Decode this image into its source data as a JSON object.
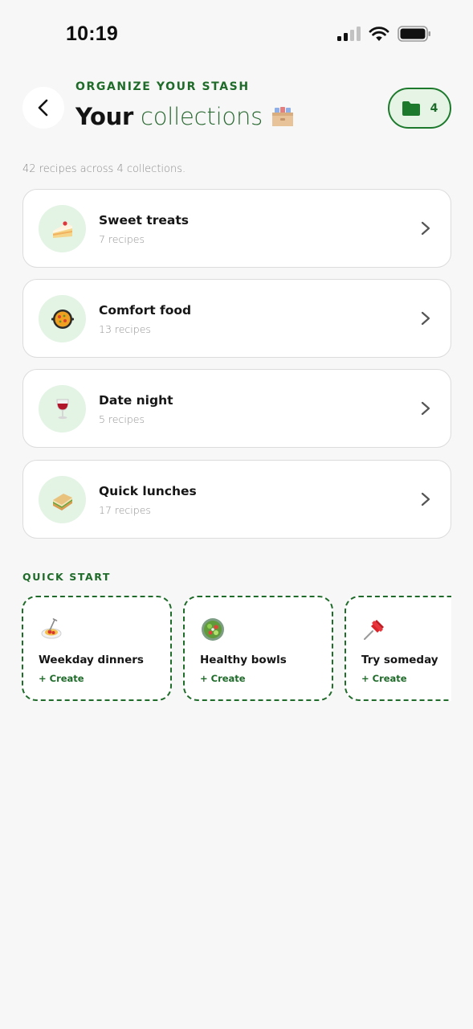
{
  "status_bar": {
    "time": "10:19"
  },
  "header": {
    "eyebrow": "ORGANIZE YOUR STASH",
    "title_strong": "Your",
    "title_light": "collections",
    "collections_count": "4"
  },
  "summary": "42 recipes across 4 collections.",
  "collections": [
    {
      "name": "Sweet treats",
      "count_label": "7 recipes",
      "icon": "cake-slice-icon"
    },
    {
      "name": "Comfort food",
      "count_label": "13 recipes",
      "icon": "paella-pan-icon"
    },
    {
      "name": "Date night",
      "count_label": "5 recipes",
      "icon": "wine-glass-icon"
    },
    {
      "name": "Quick lunches",
      "count_label": "17 recipes",
      "icon": "sandwich-icon"
    }
  ],
  "quick_start": {
    "label": "QUICK START",
    "items": [
      {
        "title": "Weekday dinners",
        "action": "+ Create",
        "icon": "spaghetti-icon"
      },
      {
        "title": "Healthy bowls",
        "action": "+ Create",
        "icon": "salad-bowl-icon"
      },
      {
        "title": "Try someday",
        "action": "+ Create",
        "icon": "pushpin-icon"
      }
    ]
  },
  "colors": {
    "accent_green": "#1f6b2a",
    "pill_background": "#e5f4e5",
    "icon_circle_background": "#e3f3e4",
    "page_background": "#f7f7f7"
  }
}
